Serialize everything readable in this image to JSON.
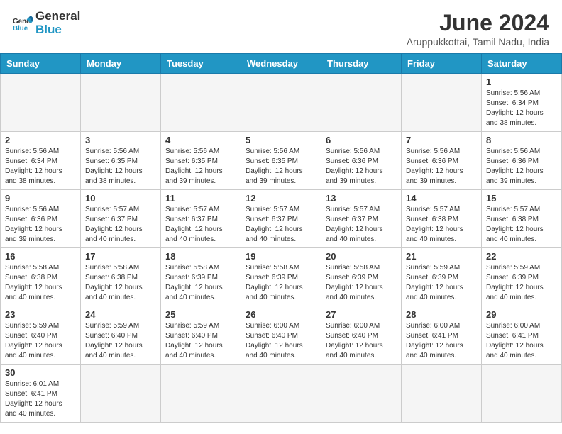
{
  "header": {
    "logo_general": "General",
    "logo_blue": "Blue",
    "title": "June 2024",
    "subtitle": "Aruppukkottai, Tamil Nadu, India"
  },
  "weekdays": [
    "Sunday",
    "Monday",
    "Tuesday",
    "Wednesday",
    "Thursday",
    "Friday",
    "Saturday"
  ],
  "weeks": [
    [
      {
        "day": "",
        "empty": true
      },
      {
        "day": "",
        "empty": true
      },
      {
        "day": "",
        "empty": true
      },
      {
        "day": "",
        "empty": true
      },
      {
        "day": "",
        "empty": true
      },
      {
        "day": "",
        "empty": true
      },
      {
        "day": "1",
        "sunrise": "5:56 AM",
        "sunset": "6:34 PM",
        "daylight": "12 hours and 38 minutes."
      }
    ],
    [
      {
        "day": "2",
        "sunrise": "5:56 AM",
        "sunset": "6:34 PM",
        "daylight": "12 hours and 38 minutes."
      },
      {
        "day": "3",
        "sunrise": "5:56 AM",
        "sunset": "6:35 PM",
        "daylight": "12 hours and 38 minutes."
      },
      {
        "day": "4",
        "sunrise": "5:56 AM",
        "sunset": "6:35 PM",
        "daylight": "12 hours and 39 minutes."
      },
      {
        "day": "5",
        "sunrise": "5:56 AM",
        "sunset": "6:35 PM",
        "daylight": "12 hours and 39 minutes."
      },
      {
        "day": "6",
        "sunrise": "5:56 AM",
        "sunset": "6:36 PM",
        "daylight": "12 hours and 39 minutes."
      },
      {
        "day": "7",
        "sunrise": "5:56 AM",
        "sunset": "6:36 PM",
        "daylight": "12 hours and 39 minutes."
      },
      {
        "day": "8",
        "sunrise": "5:56 AM",
        "sunset": "6:36 PM",
        "daylight": "12 hours and 39 minutes."
      }
    ],
    [
      {
        "day": "9",
        "sunrise": "5:56 AM",
        "sunset": "6:36 PM",
        "daylight": "12 hours and 39 minutes."
      },
      {
        "day": "10",
        "sunrise": "5:57 AM",
        "sunset": "6:37 PM",
        "daylight": "12 hours and 40 minutes."
      },
      {
        "day": "11",
        "sunrise": "5:57 AM",
        "sunset": "6:37 PM",
        "daylight": "12 hours and 40 minutes."
      },
      {
        "day": "12",
        "sunrise": "5:57 AM",
        "sunset": "6:37 PM",
        "daylight": "12 hours and 40 minutes."
      },
      {
        "day": "13",
        "sunrise": "5:57 AM",
        "sunset": "6:37 PM",
        "daylight": "12 hours and 40 minutes."
      },
      {
        "day": "14",
        "sunrise": "5:57 AM",
        "sunset": "6:38 PM",
        "daylight": "12 hours and 40 minutes."
      },
      {
        "day": "15",
        "sunrise": "5:57 AM",
        "sunset": "6:38 PM",
        "daylight": "12 hours and 40 minutes."
      }
    ],
    [
      {
        "day": "16",
        "sunrise": "5:58 AM",
        "sunset": "6:38 PM",
        "daylight": "12 hours and 40 minutes."
      },
      {
        "day": "17",
        "sunrise": "5:58 AM",
        "sunset": "6:38 PM",
        "daylight": "12 hours and 40 minutes."
      },
      {
        "day": "18",
        "sunrise": "5:58 AM",
        "sunset": "6:39 PM",
        "daylight": "12 hours and 40 minutes."
      },
      {
        "day": "19",
        "sunrise": "5:58 AM",
        "sunset": "6:39 PM",
        "daylight": "12 hours and 40 minutes."
      },
      {
        "day": "20",
        "sunrise": "5:58 AM",
        "sunset": "6:39 PM",
        "daylight": "12 hours and 40 minutes."
      },
      {
        "day": "21",
        "sunrise": "5:59 AM",
        "sunset": "6:39 PM",
        "daylight": "12 hours and 40 minutes."
      },
      {
        "day": "22",
        "sunrise": "5:59 AM",
        "sunset": "6:39 PM",
        "daylight": "12 hours and 40 minutes."
      }
    ],
    [
      {
        "day": "23",
        "sunrise": "5:59 AM",
        "sunset": "6:40 PM",
        "daylight": "12 hours and 40 minutes."
      },
      {
        "day": "24",
        "sunrise": "5:59 AM",
        "sunset": "6:40 PM",
        "daylight": "12 hours and 40 minutes."
      },
      {
        "day": "25",
        "sunrise": "5:59 AM",
        "sunset": "6:40 PM",
        "daylight": "12 hours and 40 minutes."
      },
      {
        "day": "26",
        "sunrise": "6:00 AM",
        "sunset": "6:40 PM",
        "daylight": "12 hours and 40 minutes."
      },
      {
        "day": "27",
        "sunrise": "6:00 AM",
        "sunset": "6:40 PM",
        "daylight": "12 hours and 40 minutes."
      },
      {
        "day": "28",
        "sunrise": "6:00 AM",
        "sunset": "6:41 PM",
        "daylight": "12 hours and 40 minutes."
      },
      {
        "day": "29",
        "sunrise": "6:00 AM",
        "sunset": "6:41 PM",
        "daylight": "12 hours and 40 minutes."
      }
    ],
    [
      {
        "day": "30",
        "sunrise": "6:01 AM",
        "sunset": "6:41 PM",
        "daylight": "12 hours and 40 minutes."
      },
      {
        "day": "",
        "empty": true
      },
      {
        "day": "",
        "empty": true
      },
      {
        "day": "",
        "empty": true
      },
      {
        "day": "",
        "empty": true
      },
      {
        "day": "",
        "empty": true
      },
      {
        "day": "",
        "empty": true
      }
    ]
  ],
  "labels": {
    "sunrise": "Sunrise:",
    "sunset": "Sunset:",
    "daylight": "Daylight:"
  }
}
